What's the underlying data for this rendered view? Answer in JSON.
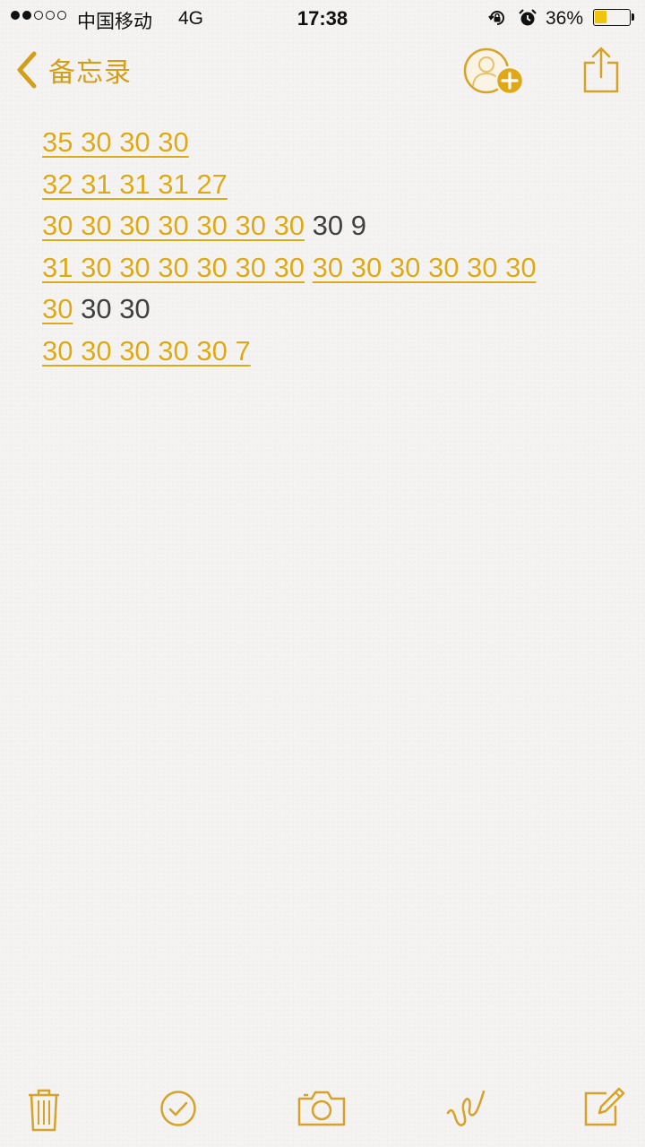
{
  "status_bar": {
    "carrier": "中国移动",
    "network": "4G",
    "time": "17:38",
    "battery_percent": "36%",
    "battery_level": 0.36,
    "signal_bars": 2,
    "signal_total": 5,
    "icons": [
      "rotation-lock-icon",
      "alarm-icon"
    ]
  },
  "nav": {
    "back_label": "备忘录",
    "icons": [
      "chevron-left-icon",
      "add-person-icon",
      "share-icon"
    ]
  },
  "note": {
    "lines": [
      [
        {
          "text": "35 30 30 30",
          "link": true
        }
      ],
      [
        {
          "text": "32 31 31 31 27",
          "link": true
        }
      ],
      [
        {
          "text": "30 30 30 30 30 30 30",
          "link": true
        },
        {
          "text": " 30 9",
          "link": false
        }
      ],
      [
        {
          "text": "31 30 30 30 30 30 30",
          "link": true
        },
        {
          "text": " ",
          "link": false
        },
        {
          "text": "30 30 30 30 30 30",
          "link": true
        }
      ],
      [
        {
          "text": "30",
          "link": true
        },
        {
          "text": " 30 30",
          "link": false
        }
      ],
      [
        {
          "text": "30 30 30 30 30 7",
          "link": true
        }
      ]
    ]
  },
  "toolbar": {
    "icons": [
      "trash-icon",
      "checklist-icon",
      "camera-icon",
      "sketch-icon",
      "compose-icon"
    ]
  },
  "colors": {
    "accent": "#e0a817",
    "text": "#404040",
    "background": "#f4f3f1"
  }
}
